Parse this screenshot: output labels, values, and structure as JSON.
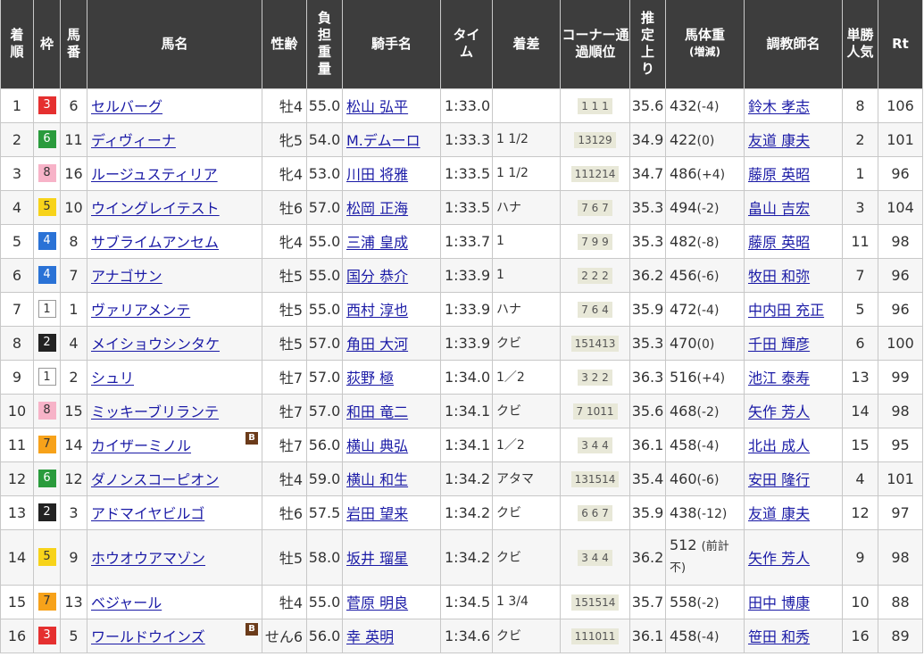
{
  "headers": {
    "rank": "着順",
    "frame": "枠",
    "number": "馬番",
    "horse": "馬名",
    "sex_age": "性齢",
    "weight": "負担重量",
    "jockey": "騎手名",
    "time": "タイム",
    "margin": "着差",
    "corner": "コーナー通過順位",
    "last": "推定上り",
    "body_weight": "馬体重",
    "body_weight_sub": "(増減)",
    "trainer": "調教師名",
    "popularity": "単勝人気",
    "rating": "Rt"
  },
  "rows": [
    {
      "rank": "1",
      "frame": "3",
      "number": "6",
      "horse": "セルバーグ",
      "blinker": "",
      "sex_age": "牡4",
      "weight": "55.0",
      "jockey": "松山 弘平",
      "time": "1:33.0",
      "margin": "",
      "corner": "1 1 1",
      "last": "35.6",
      "body_weight": "432",
      "bw_diff": "(-4)",
      "trainer": "鈴木 孝志",
      "popularity": "8",
      "rating": "106"
    },
    {
      "rank": "2",
      "frame": "6",
      "number": "11",
      "horse": "ディヴィーナ",
      "blinker": "",
      "sex_age": "牝5",
      "weight": "54.0",
      "jockey": "M.デムーロ",
      "time": "1:33.3",
      "margin": "1 1/2",
      "corner": "13129",
      "last": "34.9",
      "body_weight": "422",
      "bw_diff": "(0)",
      "trainer": "友道 康夫",
      "popularity": "2",
      "rating": "101"
    },
    {
      "rank": "3",
      "frame": "8",
      "number": "16",
      "horse": "ルージュスティリア",
      "blinker": "",
      "sex_age": "牝4",
      "weight": "53.0",
      "jockey": "川田 将雅",
      "time": "1:33.5",
      "margin": "1 1/2",
      "corner": "111214",
      "last": "34.7",
      "body_weight": "486",
      "bw_diff": "(+4)",
      "trainer": "藤原 英昭",
      "popularity": "1",
      "rating": "96"
    },
    {
      "rank": "4",
      "frame": "5",
      "number": "10",
      "horse": "ウイングレイテスト",
      "blinker": "",
      "sex_age": "牡6",
      "weight": "57.0",
      "jockey": "松岡 正海",
      "time": "1:33.5",
      "margin": "ハナ",
      "corner": "7 6 7",
      "last": "35.3",
      "body_weight": "494",
      "bw_diff": "(-2)",
      "trainer": "畠山 吉宏",
      "popularity": "3",
      "rating": "104"
    },
    {
      "rank": "5",
      "frame": "4",
      "number": "8",
      "horse": "サブライムアンセム",
      "blinker": "",
      "sex_age": "牝4",
      "weight": "55.0",
      "jockey": "三浦 皇成",
      "time": "1:33.7",
      "margin": "1",
      "corner": "7 9 9",
      "last": "35.3",
      "body_weight": "482",
      "bw_diff": "(-8)",
      "trainer": "藤原 英昭",
      "popularity": "11",
      "rating": "98"
    },
    {
      "rank": "6",
      "frame": "4",
      "number": "7",
      "horse": "アナゴサン",
      "blinker": "",
      "sex_age": "牡5",
      "weight": "55.0",
      "jockey": "国分 恭介",
      "time": "1:33.9",
      "margin": "1",
      "corner": "2 2 2",
      "last": "36.2",
      "body_weight": "456",
      "bw_diff": "(-6)",
      "trainer": "牧田 和弥",
      "popularity": "7",
      "rating": "96"
    },
    {
      "rank": "7",
      "frame": "1",
      "number": "1",
      "horse": "ヴァリアメンテ",
      "blinker": "",
      "sex_age": "牡5",
      "weight": "55.0",
      "jockey": "西村 淳也",
      "time": "1:33.9",
      "margin": "ハナ",
      "corner": "7 6 4",
      "last": "35.9",
      "body_weight": "472",
      "bw_diff": "(-4)",
      "trainer": "中内田 充正",
      "popularity": "5",
      "rating": "96"
    },
    {
      "rank": "8",
      "frame": "2",
      "number": "4",
      "horse": "メイショウシンタケ",
      "blinker": "",
      "sex_age": "牡5",
      "weight": "57.0",
      "jockey": "角田 大河",
      "time": "1:33.9",
      "margin": "クビ",
      "corner": "151413",
      "last": "35.3",
      "body_weight": "470",
      "bw_diff": "(0)",
      "trainer": "千田 輝彦",
      "popularity": "6",
      "rating": "100"
    },
    {
      "rank": "9",
      "frame": "1",
      "number": "2",
      "horse": "シュリ",
      "blinker": "",
      "sex_age": "牡7",
      "weight": "57.0",
      "jockey": "荻野 極",
      "time": "1:34.0",
      "margin": "1／2",
      "corner": "3 2 2",
      "last": "36.3",
      "body_weight": "516",
      "bw_diff": "(+4)",
      "trainer": "池江 泰寿",
      "popularity": "13",
      "rating": "99"
    },
    {
      "rank": "10",
      "frame": "8",
      "number": "15",
      "horse": "ミッキーブリランテ",
      "blinker": "",
      "sex_age": "牡7",
      "weight": "57.0",
      "jockey": "和田 竜二",
      "time": "1:34.1",
      "margin": "クビ",
      "corner": "7 1011",
      "last": "35.6",
      "body_weight": "468",
      "bw_diff": "(-2)",
      "trainer": "矢作 芳人",
      "popularity": "14",
      "rating": "98"
    },
    {
      "rank": "11",
      "frame": "7",
      "number": "14",
      "horse": "カイザーミノル",
      "blinker": "B",
      "sex_age": "牡7",
      "weight": "56.0",
      "jockey": "横山 典弘",
      "time": "1:34.1",
      "margin": "1／2",
      "corner": "3 4 4",
      "last": "36.1",
      "body_weight": "458",
      "bw_diff": "(-4)",
      "trainer": "北出 成人",
      "popularity": "15",
      "rating": "95"
    },
    {
      "rank": "12",
      "frame": "6",
      "number": "12",
      "horse": "ダノンスコーピオン",
      "blinker": "",
      "sex_age": "牡4",
      "weight": "59.0",
      "jockey": "横山 和生",
      "time": "1:34.2",
      "margin": "アタマ",
      "corner": "131514",
      "last": "35.4",
      "body_weight": "460",
      "bw_diff": "(-6)",
      "trainer": "安田 隆行",
      "popularity": "4",
      "rating": "101"
    },
    {
      "rank": "13",
      "frame": "2",
      "number": "3",
      "horse": "アドマイヤビルゴ",
      "blinker": "",
      "sex_age": "牡6",
      "weight": "57.5",
      "jockey": "岩田 望来",
      "time": "1:34.2",
      "margin": "クビ",
      "corner": "6 6 7",
      "last": "35.9",
      "body_weight": "438",
      "bw_diff": "(-12)",
      "trainer": "友道 康夫",
      "popularity": "12",
      "rating": "97"
    },
    {
      "rank": "14",
      "frame": "5",
      "number": "9",
      "horse": "ホウオウアマゾン",
      "blinker": "",
      "sex_age": "牡5",
      "weight": "58.0",
      "jockey": "坂井 瑠星",
      "time": "1:34.2",
      "margin": "クビ",
      "corner": "3 4 4",
      "last": "36.2",
      "body_weight": "512",
      "bw_diff": "(前計不)",
      "trainer": "矢作 芳人",
      "popularity": "9",
      "rating": "98"
    },
    {
      "rank": "15",
      "frame": "7",
      "number": "13",
      "horse": "ベジャール",
      "blinker": "",
      "sex_age": "牡4",
      "weight": "55.0",
      "jockey": "菅原 明良",
      "time": "1:34.5",
      "margin": "1 3/4",
      "corner": "151514",
      "last": "35.7",
      "body_weight": "558",
      "bw_diff": "(-2)",
      "trainer": "田中 博康",
      "popularity": "10",
      "rating": "88"
    },
    {
      "rank": "16",
      "frame": "3",
      "number": "5",
      "horse": "ワールドウインズ",
      "blinker": "B",
      "sex_age": "せん6",
      "weight": "56.0",
      "jockey": "幸 英明",
      "time": "1:34.6",
      "margin": "クビ",
      "corner": "111011",
      "last": "36.1",
      "body_weight": "458",
      "bw_diff": "(-4)",
      "trainer": "笹田 和秀",
      "popularity": "16",
      "rating": "89"
    }
  ]
}
